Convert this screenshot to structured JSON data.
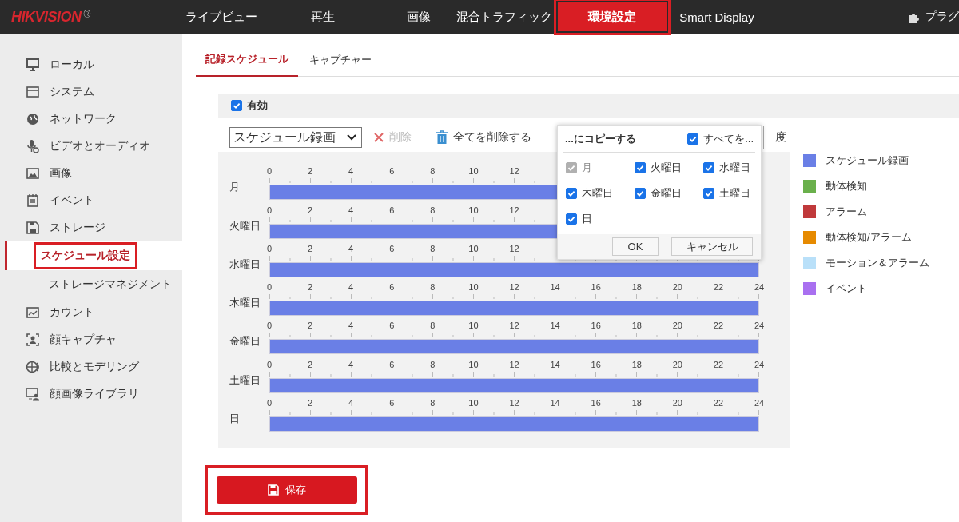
{
  "header": {
    "logo": "HIKVISION",
    "logo_mark": "®",
    "nav": [
      {
        "label": "ライブビュー",
        "selected": false
      },
      {
        "label": "再生",
        "selected": false
      },
      {
        "label": "画像",
        "selected": false
      },
      {
        "label": "混合トラフィック",
        "selected": false
      },
      {
        "label": "環境設定",
        "selected": true,
        "annotated": true
      },
      {
        "label": "Smart Display",
        "selected": false
      }
    ],
    "plugin": {
      "label": "プラグ"
    }
  },
  "sidebar": {
    "items": [
      {
        "label": "ローカル",
        "selected": false
      },
      {
        "label": "システム",
        "selected": false
      },
      {
        "label": "ネットワーク",
        "selected": false
      },
      {
        "label": "ビデオとオーディオ",
        "selected": false
      },
      {
        "label": "画像",
        "selected": false
      },
      {
        "label": "イベント",
        "selected": false
      },
      {
        "label": "ストレージ",
        "selected": false,
        "children": [
          {
            "label": "スケジュール設定",
            "selected": true,
            "annotated": true
          },
          {
            "label": "ストレージマネジメント",
            "selected": false
          }
        ]
      },
      {
        "label": "カウント",
        "selected": false
      },
      {
        "label": "顔キャプチャ",
        "selected": false
      },
      {
        "label": "比較とモデリング",
        "selected": false
      },
      {
        "label": "顔画像ライブラリ",
        "selected": false
      }
    ]
  },
  "tabs": [
    {
      "label": "記録スケジュール",
      "selected": true
    },
    {
      "label": "キャプチャー",
      "selected": false
    }
  ],
  "enable": {
    "label": "有効",
    "checked": true
  },
  "toolbar": {
    "select": {
      "value": "スケジュール録画"
    },
    "delete": {
      "label": "削除",
      "disabled": true
    },
    "delete_all": {
      "label": "全てを削除する"
    },
    "copy_button": {
      "label": "度"
    }
  },
  "days": [
    {
      "label": "月",
      "ticks": [
        "0",
        "2",
        "4",
        "6",
        "8",
        "10",
        "12"
      ],
      "kind": "schedule",
      "level": 1
    },
    {
      "label": "火曜日",
      "ticks": [
        "0",
        "2",
        "4",
        "6",
        "8",
        "10",
        "12"
      ],
      "kind": "schedule",
      "level": 1
    },
    {
      "label": "水曜日",
      "ticks": [
        "0",
        "2",
        "4",
        "6",
        "8",
        "10",
        "12"
      ],
      "kind": "schedule",
      "level": 1
    },
    {
      "label": "木曜日",
      "ticks": [
        "0",
        "2",
        "4",
        "6",
        "8",
        "10",
        "12",
        "14",
        "16",
        "18",
        "20",
        "22",
        "24"
      ],
      "kind": "schedule",
      "level": 1
    },
    {
      "label": "金曜日",
      "ticks": [
        "0",
        "2",
        "4",
        "6",
        "8",
        "10",
        "12",
        "14",
        "16",
        "18",
        "20",
        "22",
        "24"
      ],
      "kind": "schedule",
      "level": 1
    },
    {
      "label": "土曜日",
      "ticks": [
        "0",
        "2",
        "4",
        "6",
        "8",
        "10",
        "12",
        "14",
        "16",
        "18",
        "20",
        "22",
        "24"
      ],
      "kind": "schedule",
      "level": 1
    },
    {
      "label": "日",
      "ticks": [
        "0",
        "2",
        "4",
        "6",
        "8",
        "10",
        "12",
        "14",
        "16",
        "18",
        "20",
        "22",
        "24"
      ],
      "kind": "schedule",
      "level": 1
    }
  ],
  "legend": [
    {
      "label": "スケジュール録画",
      "kind": "schedule",
      "color": "#6a7fe6"
    },
    {
      "label": "動体検知",
      "kind": "motion",
      "color": "#6ab04c"
    },
    {
      "label": "アラーム",
      "kind": "alarm",
      "color": "#c0393b"
    },
    {
      "label": "動体検知/アラーム",
      "kind": "motion_or_alarm",
      "color": "#e68a00"
    },
    {
      "label": "モーション＆アラーム",
      "kind": "motion_and_alarm",
      "color": "#b9e0f9"
    },
    {
      "label": "イベント",
      "kind": "event",
      "color": "#a970f0"
    }
  ],
  "copy_popup": {
    "title": "...にコピーする",
    "select_all": {
      "label": "すべてを...",
      "checked": true
    },
    "days": [
      {
        "label": "月",
        "checked": true,
        "disabled": true
      },
      {
        "label": "火曜日",
        "checked": true,
        "disabled": false
      },
      {
        "label": "水曜日",
        "checked": true,
        "disabled": false
      },
      {
        "label": "木曜日",
        "checked": true,
        "disabled": false
      },
      {
        "label": "金曜日",
        "checked": true,
        "disabled": false
      },
      {
        "label": "土曜日",
        "checked": true,
        "disabled": false
      },
      {
        "label": "日",
        "checked": true,
        "disabled": false
      }
    ],
    "buttons": [
      {
        "label": "OK"
      },
      {
        "label": "キャンセル"
      }
    ]
  },
  "save": {
    "label": "保存",
    "annotated": true
  }
}
